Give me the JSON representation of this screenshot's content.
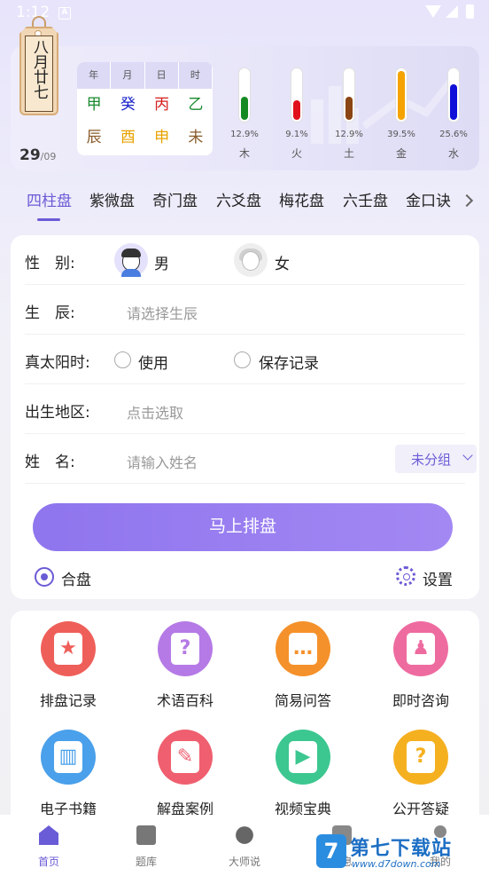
{
  "status": {
    "time": "1:12",
    "a_icon": "A"
  },
  "top": {
    "tag_text": "八月廿七",
    "day": "29",
    "month": "/09",
    "pillar_headers": [
      "年",
      "月",
      "日",
      "时"
    ],
    "pillar_stems": [
      "甲",
      "癸",
      "丙",
      "乙"
    ],
    "pillar_branches": [
      "辰",
      "酉",
      "申",
      "未"
    ],
    "stem_colors": [
      "#1a8a2e",
      "#1a24c8",
      "#d62020",
      "#1a8a2e"
    ],
    "branch_colors": [
      "#8a5a2a",
      "#e8a200",
      "#e8a200",
      "#8a5a2a"
    ],
    "elements": [
      {
        "name": "木",
        "pct": "12.9%",
        "value": 0.129,
        "color": "#168a22"
      },
      {
        "name": "火",
        "pct": "9.1%",
        "value": 0.091,
        "color": "#e0101a"
      },
      {
        "name": "土",
        "pct": "12.9%",
        "value": 0.129,
        "color": "#8b4513"
      },
      {
        "name": "金",
        "pct": "39.5%",
        "value": 0.395,
        "color": "#f5a300"
      },
      {
        "name": "水",
        "pct": "25.6%",
        "value": 0.256,
        "color": "#1010d8"
      }
    ]
  },
  "tabs": [
    "四柱盘",
    "紫微盘",
    "奇门盘",
    "六爻盘",
    "梅花盘",
    "六壬盘",
    "金口诀"
  ],
  "form": {
    "gender_label": "性　别:",
    "male": "男",
    "female": "女",
    "birth_label": "生　辰:",
    "birth_placeholder": "请选择生辰",
    "solar_label": "真太阳时:",
    "solar_use": "使用",
    "save_record": "保存记录",
    "place_label": "出生地区:",
    "place_placeholder": "点击选取",
    "name_label": "姓　名:",
    "name_placeholder": "请输入姓名",
    "group": "未分组",
    "submit": "马上排盘",
    "hepan": "合盘",
    "settings": "设置"
  },
  "features": [
    {
      "label": "排盘记录",
      "color": "#ef5f5a",
      "glyph": "★"
    },
    {
      "label": "术语百科",
      "color": "#b57ae6",
      "glyph": "?"
    },
    {
      "label": "简易问答",
      "color": "#f5912a",
      "glyph": "…"
    },
    {
      "label": "即时咨询",
      "color": "#ee6ba0",
      "glyph": "♟"
    },
    {
      "label": "电子书籍",
      "color": "#4aa0ea",
      "glyph": "▥"
    },
    {
      "label": "解盘案例",
      "color": "#ef5f6f",
      "glyph": "✎"
    },
    {
      "label": "视频宝典",
      "color": "#3cc790",
      "glyph": "▶"
    },
    {
      "label": "公开答疑",
      "color": "#f5b020",
      "glyph": "?"
    }
  ],
  "nav": [
    "首页",
    "题库",
    "大师说",
    "消息",
    "我的"
  ],
  "watermark": {
    "logo": "7",
    "title": "第七下载站",
    "url": "www.d7down.com"
  }
}
